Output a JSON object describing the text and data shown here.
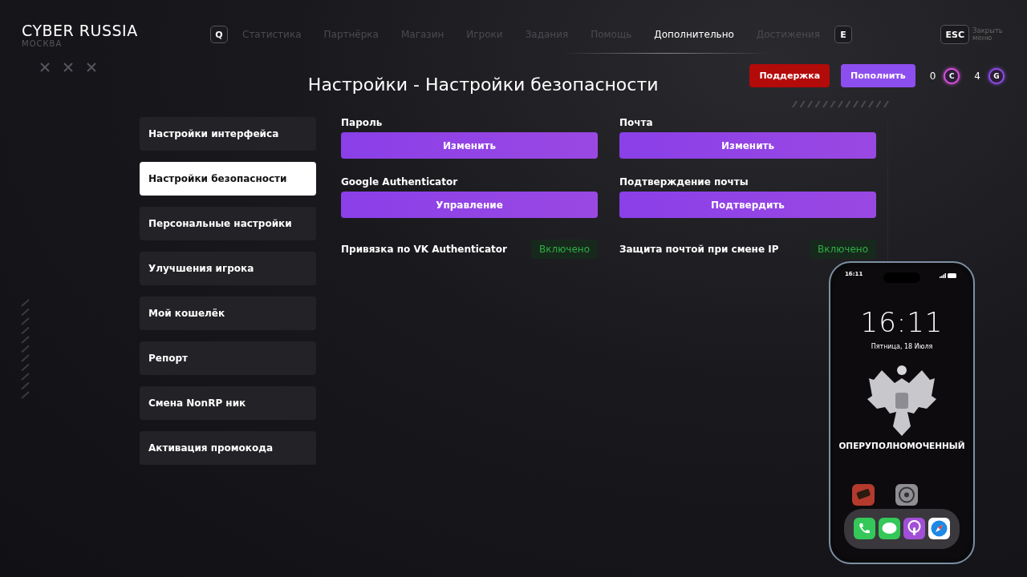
{
  "brand": {
    "title": "CYBER RUSSIA",
    "city": "МОСКВА"
  },
  "nav": {
    "prev_key": "Q",
    "next_key": "E",
    "tabs": [
      {
        "label": "Статистика",
        "selected": false
      },
      {
        "label": "Партнёрка",
        "selected": false
      },
      {
        "label": "Магазин",
        "selected": false
      },
      {
        "label": "Игроки",
        "selected": false
      },
      {
        "label": "Задания",
        "selected": false
      },
      {
        "label": "Помощь",
        "selected": false
      },
      {
        "label": "Дополнительно",
        "selected": true
      },
      {
        "label": "Достижения",
        "selected": false
      }
    ]
  },
  "close": {
    "key": "ESC",
    "label": "Закрыть меню"
  },
  "page_title": "Настройки - Настройки безопасности",
  "actions": {
    "support": "Поддержка",
    "topup": "Пополнить"
  },
  "currencies": [
    {
      "amount": "0",
      "symbol": "C",
      "color": "#d94fe0"
    },
    {
      "amount": "4",
      "symbol": "G",
      "color": "#8e4be8"
    }
  ],
  "sidebar": {
    "items": [
      {
        "label": "Настройки интерфейса",
        "selected": false
      },
      {
        "label": "Настройки безопасности",
        "selected": true
      },
      {
        "label": "Персональные настройки",
        "selected": false
      },
      {
        "label": "Улучшения игрока",
        "selected": false
      },
      {
        "label": "Мой кошелёк",
        "selected": false
      },
      {
        "label": "Репорт",
        "selected": false
      },
      {
        "label": "Смена NonRP ник",
        "selected": false
      },
      {
        "label": "Активация промокода",
        "selected": false
      }
    ]
  },
  "settings": [
    {
      "kind": "button",
      "label": "Пароль",
      "action": "Изменить"
    },
    {
      "kind": "button",
      "label": "Почта",
      "action": "Изменить"
    },
    {
      "kind": "button",
      "label": "Google Authenticator",
      "action": "Управление"
    },
    {
      "kind": "button",
      "label": "Подтверждение почты",
      "action": "Подтвердить"
    },
    {
      "kind": "toggle",
      "label": "Привязка по VK Authenticator",
      "status": "Включено",
      "on": true
    },
    {
      "kind": "toggle",
      "label": "Защита почтой при смене IP",
      "status": "Включено",
      "on": true
    }
  ],
  "phone": {
    "status_time": "16:11",
    "clock": "16:11",
    "date": "Пятница, 18 Июля",
    "caption": "ОПЕРУПОЛНОМОЧЕННЫЙ"
  }
}
